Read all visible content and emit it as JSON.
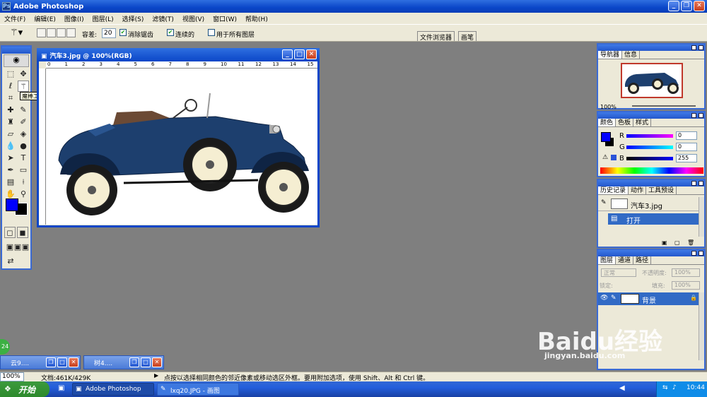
{
  "window": {
    "title": "Adobe Photoshop"
  },
  "menu": [
    "文件(F)",
    "编辑(E)",
    "图像(I)",
    "图层(L)",
    "选择(S)",
    "滤镜(T)",
    "视图(V)",
    "窗口(W)",
    "帮助(H)"
  ],
  "options": {
    "tolerance_label": "容差:",
    "tolerance_value": "20",
    "antialias_label": "消除锯齿",
    "contiguous_label": "连续的",
    "all_layers_label": "用于所有图层",
    "file_browser_tab": "文件浏览器",
    "brush_tab": "画笔"
  },
  "toolbox": {
    "tooltip": "魔棒工具(W)"
  },
  "document": {
    "title": "汽车3.jpg @ 100%(RGB)",
    "ruler_numbers": [
      "0",
      "1",
      "2",
      "3",
      "4",
      "5",
      "6",
      "7",
      "8",
      "9",
      "10",
      "11",
      "12",
      "13",
      "14",
      "15"
    ]
  },
  "navigator": {
    "tabs": [
      "导航器",
      "信息"
    ],
    "zoom": "100%"
  },
  "color": {
    "tabs": [
      "颜色",
      "色板",
      "样式"
    ],
    "r_label": "R",
    "g_label": "G",
    "b_label": "B",
    "r": "0",
    "g": "0",
    "b": "255",
    "foreground": "#0000ff"
  },
  "history": {
    "tabs": [
      "历史记录",
      "动作",
      "工具预设"
    ],
    "snapshot": "汽车3.jpg",
    "step": "打开"
  },
  "layers": {
    "tabs": [
      "图层",
      "通道",
      "路径"
    ],
    "blend_mode": "正常",
    "opacity_label": "不透明度:",
    "opacity": "100%",
    "lock_label": "锁定:",
    "fill_label": "填充:",
    "fill": "100%",
    "layer_name": "背景"
  },
  "minimized": [
    {
      "title": "云9...."
    },
    {
      "title": "树4...."
    }
  ],
  "status": {
    "zoom": "100%",
    "doc": "文档:461K/429K",
    "hint": "点按以选择相同颜色的邻近像素或移动选区外框。要用附加选项，使用 Shift、Alt 和 Ctrl 键。"
  },
  "taskbar": {
    "start": "开始",
    "items": [
      "Adobe Photoshop",
      "lxq20.JPG - 画图"
    ],
    "clock": "10:44",
    "badge": "24"
  },
  "watermark": {
    "brand": "Baidu经验",
    "url": "jingyan.baidu.com"
  }
}
